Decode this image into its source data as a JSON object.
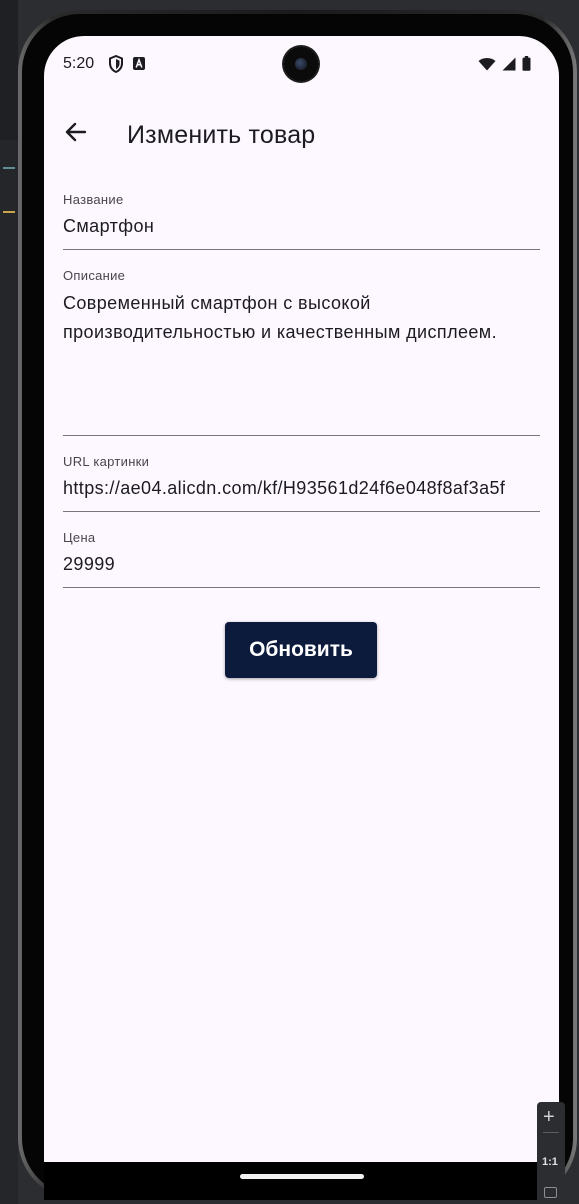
{
  "status_bar": {
    "time": "5:20",
    "icons": [
      "shield-icon",
      "a-letter-icon",
      "wifi-icon",
      "signal-icon",
      "battery-icon"
    ]
  },
  "app_bar": {
    "title": "Изменить товар",
    "back_icon": "arrow-back-icon"
  },
  "form": {
    "name": {
      "label": "Название",
      "value": "Смартфон"
    },
    "description": {
      "label": "Описание",
      "value": "Современный смартфон с высокой производительностью и качественным дисплеем."
    },
    "image_url": {
      "label": "URL картинки",
      "value": "https://ae04.alicdn.com/kf/H93561d24f6e048f8af3a5f"
    },
    "price": {
      "label": "Цена",
      "value": "29999"
    },
    "submit_label": "Обновить"
  },
  "emulator_toolbar": {
    "zoom_in": "+",
    "actual_size": "1:1"
  },
  "colors": {
    "background": "#fdf7ff",
    "button": "#0c1a3c",
    "text": "#1c1b1f"
  }
}
